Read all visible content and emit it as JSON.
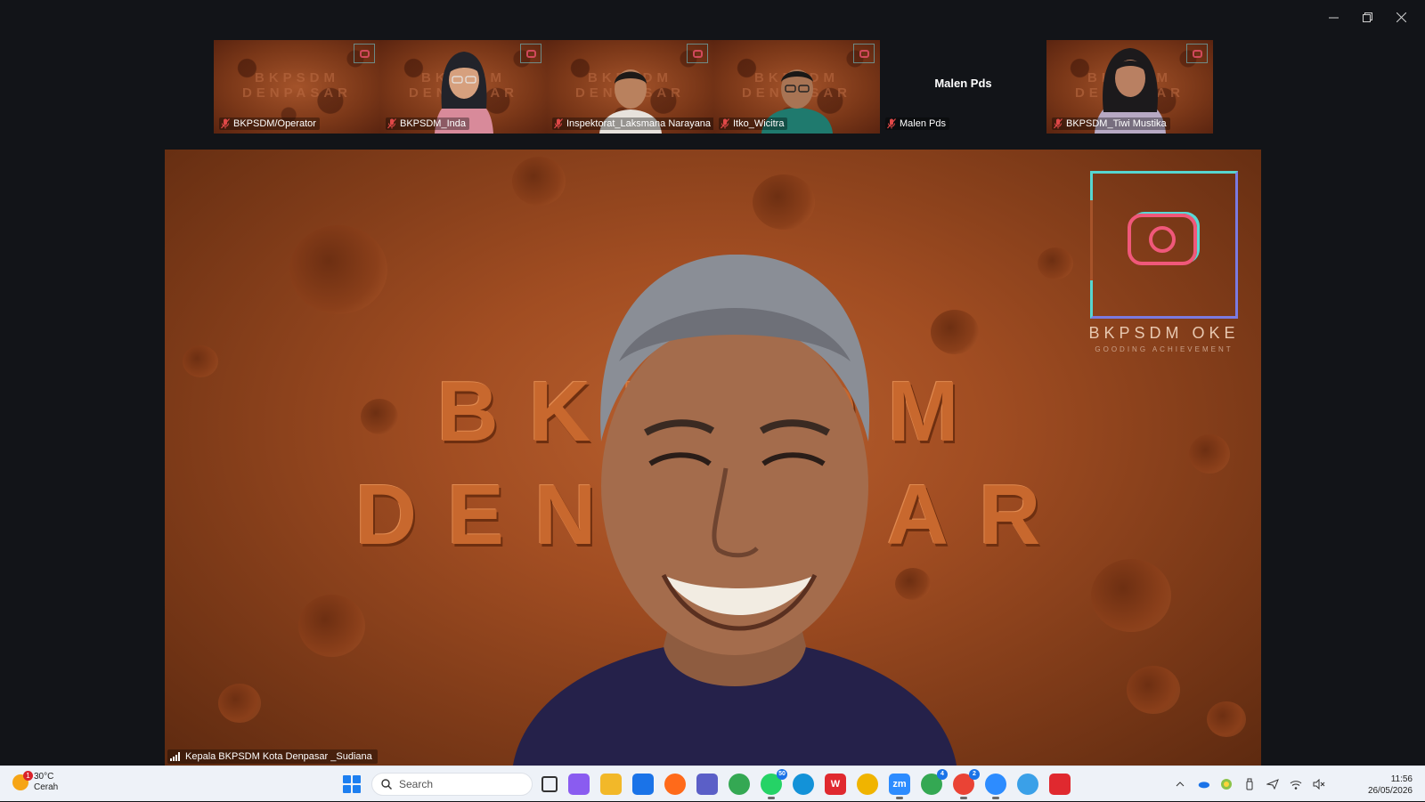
{
  "window": {
    "controls": [
      "minimize",
      "restore",
      "close"
    ]
  },
  "gallery": [
    {
      "name": "BKPSDM/Operator",
      "type": "brand",
      "brand_line1": "BKPSDM",
      "brand_line2": "DENPASAR"
    },
    {
      "name": "BKPSDM_Inda",
      "type": "person",
      "brand_line1": "BKPSDM",
      "brand_line2": "DENPASAR"
    },
    {
      "name": "Inspektorat_Laksmana Narayana",
      "type": "person",
      "brand_line1": "BKPSDM",
      "brand_line2": "DENPASAR"
    },
    {
      "name": "Itko_Wicitra",
      "type": "person",
      "brand_line1": "BKPSDM",
      "brand_line2": "DENPASAR"
    },
    {
      "name": "Malen Pds",
      "type": "no-video",
      "center_label": "Malen Pds"
    },
    {
      "name": "BKPSDM_Tiwi Mustika",
      "type": "person",
      "brand_line1": "BKPSDM",
      "brand_line2": "DENPASAR"
    }
  ],
  "speaker": {
    "name": "Kepala BKPSDM Kota Denpasar _Sudiana",
    "brand_line1": "BKPSDM",
    "brand_line2": "DENPASAR",
    "logo_text": "BKPSDM OKE",
    "logo_subtext": "GOODING ACHIEVEMENT"
  },
  "taskbar": {
    "weather": {
      "temperature": "30°C",
      "condition": "Cerah",
      "badge": "1"
    },
    "search_placeholder": "Search",
    "apps": [
      {
        "name": "task-view",
        "color": "#333333",
        "label": "",
        "badge": ""
      },
      {
        "name": "copilot",
        "color": "#8a5cf0",
        "label": "",
        "badge": ""
      },
      {
        "name": "file-explorer",
        "color": "#f2b829",
        "label": "",
        "badge": ""
      },
      {
        "name": "outlook",
        "color": "#1a73e8",
        "label": "",
        "badge": ""
      },
      {
        "name": "firefox",
        "color": "#ff6a1a",
        "label": "",
        "badge": ""
      },
      {
        "name": "teams",
        "color": "#5b5fc7",
        "label": "",
        "badge": ""
      },
      {
        "name": "chrome",
        "color": "#34a853",
        "label": "",
        "badge": ""
      },
      {
        "name": "whatsapp",
        "color": "#25d366",
        "label": "",
        "badge": "50"
      },
      {
        "name": "edge",
        "color": "#1392d8",
        "label": "",
        "badge": ""
      },
      {
        "name": "wps-office",
        "color": "#e0292f",
        "label": "W",
        "badge": ""
      },
      {
        "name": "chrome-alt",
        "color": "#f0b400",
        "label": "",
        "badge": ""
      },
      {
        "name": "zoom",
        "color": "#2d8cff",
        "label": "zm",
        "badge": ""
      },
      {
        "name": "chrome-profile-1",
        "color": "#34a853",
        "label": "",
        "badge": "4"
      },
      {
        "name": "chrome-profile-2",
        "color": "#ea4335",
        "label": "",
        "badge": "2"
      },
      {
        "name": "zoom-meeting",
        "color": "#2d8cff",
        "label": "",
        "badge": ""
      },
      {
        "name": "app-globe",
        "color": "#3aa0e8",
        "label": "",
        "badge": ""
      },
      {
        "name": "snipping-tool",
        "color": "#e0292f",
        "label": "",
        "badge": ""
      }
    ],
    "tray": [
      "chevron-up",
      "onedrive",
      "security",
      "usb",
      "location",
      "wifi",
      "volume-muted"
    ],
    "clock": {
      "time": "11:56",
      "date": "26/05/2026"
    }
  }
}
